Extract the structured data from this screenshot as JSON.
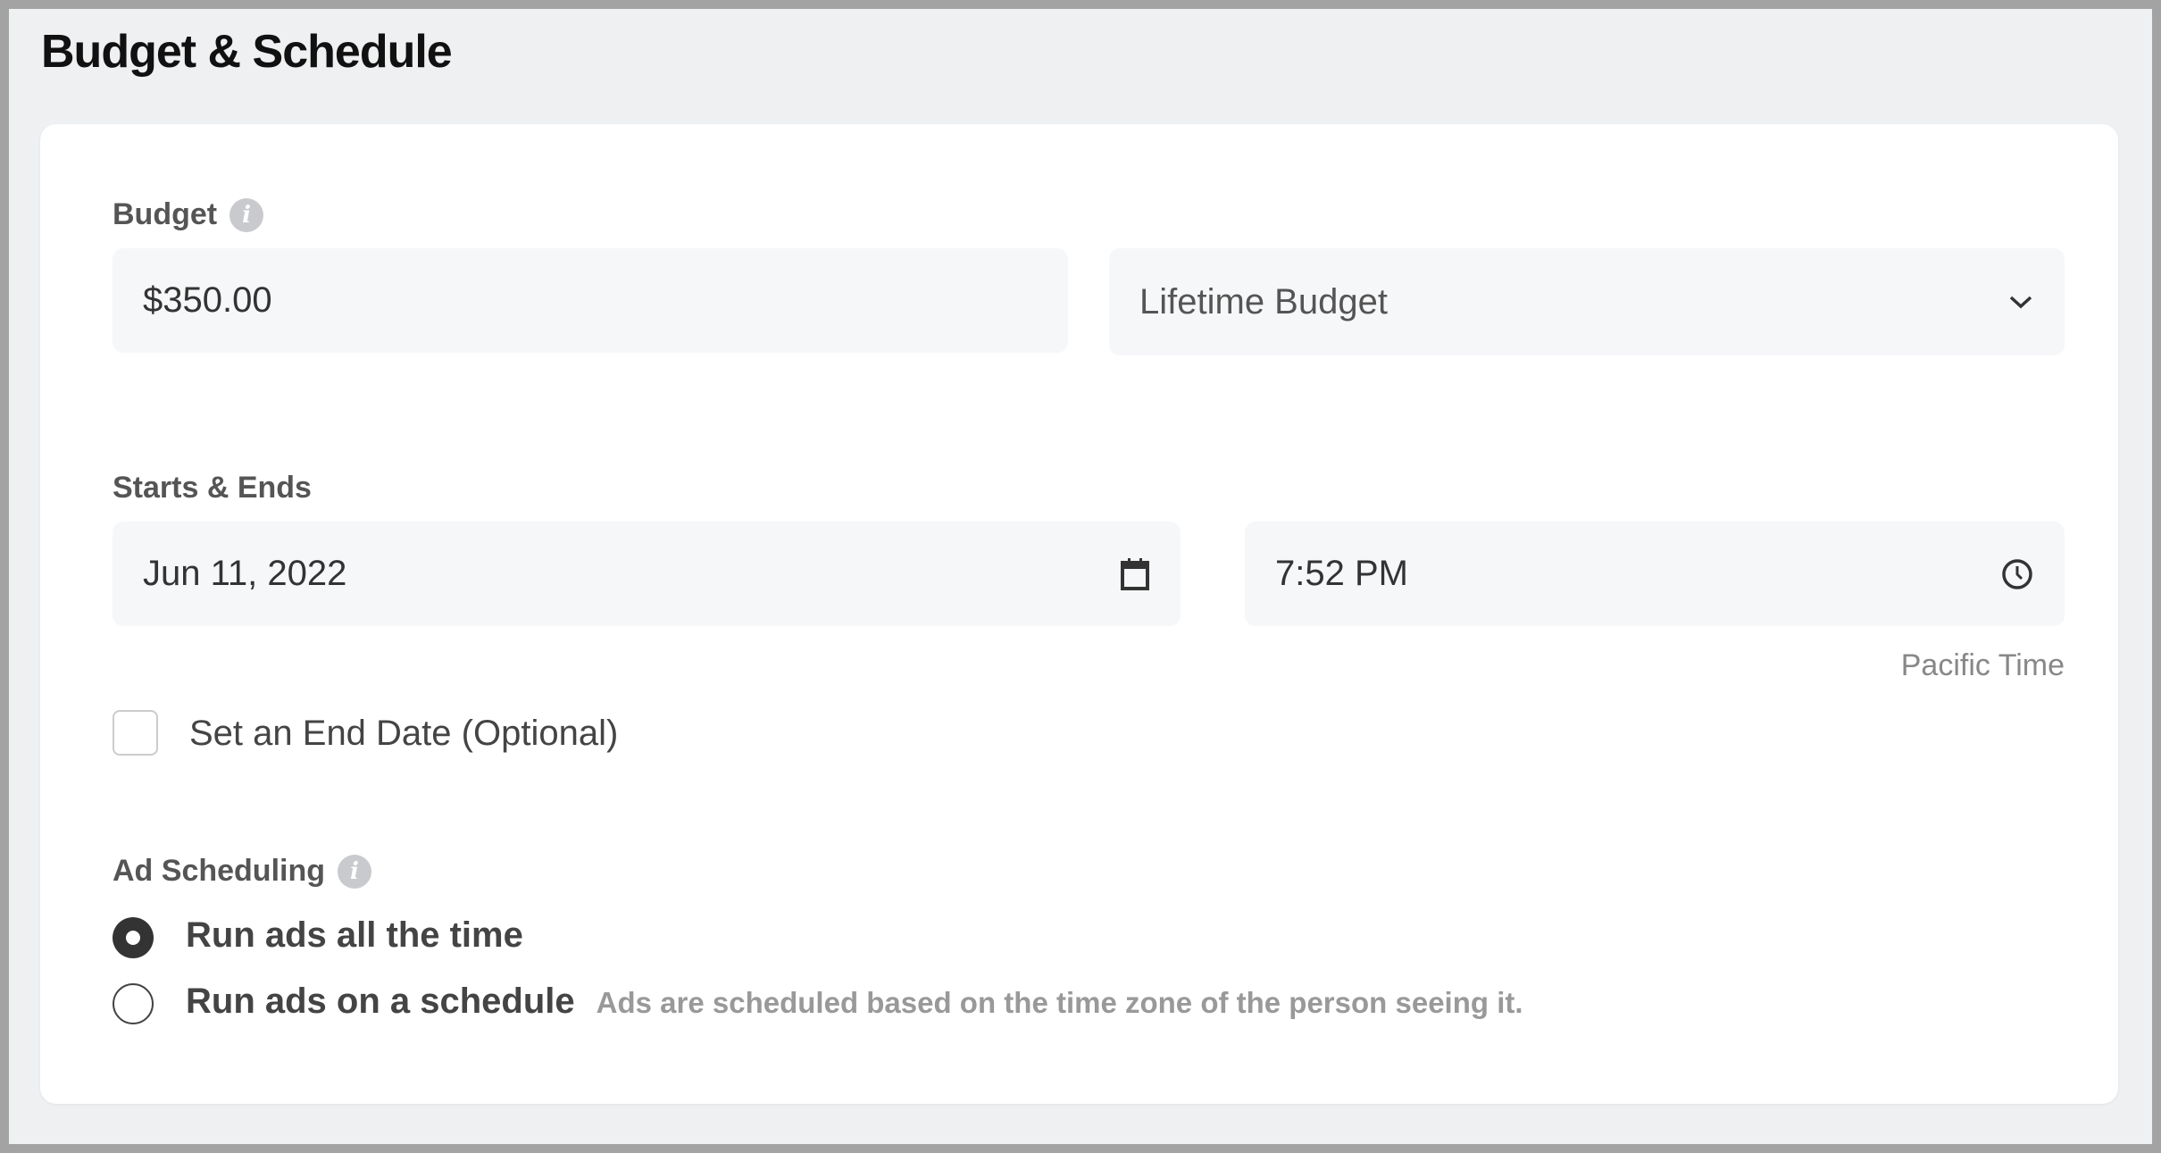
{
  "section_title": "Budget & Schedule",
  "budget": {
    "label": "Budget",
    "amount": "$350.00",
    "type_selected": "Lifetime Budget"
  },
  "schedule": {
    "label": "Starts & Ends",
    "start_date": "Jun 11, 2022",
    "start_time": "7:52 PM",
    "timezone": "Pacific Time"
  },
  "end_date": {
    "label": "Set an End Date (Optional)",
    "checked": false
  },
  "ad_scheduling": {
    "label": "Ad Scheduling",
    "options": [
      {
        "label": "Run ads all the time",
        "selected": true
      },
      {
        "label": "Run ads on a schedule",
        "selected": false,
        "help": "Ads are scheduled based on the time zone of the person seeing it."
      }
    ]
  }
}
